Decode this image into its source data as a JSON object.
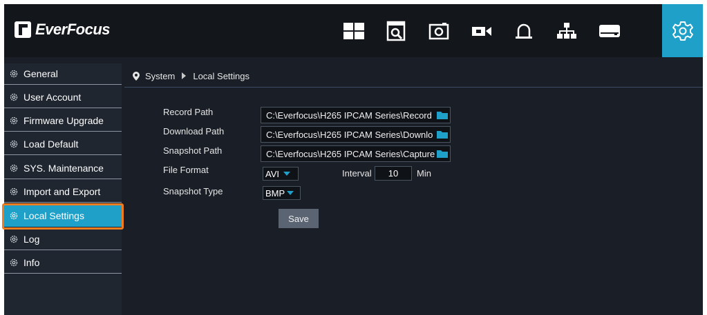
{
  "brand": {
    "logo_text": "EverFocus"
  },
  "top_nav": [
    {
      "name": "live-view",
      "icon": "grid-icon"
    },
    {
      "name": "playback",
      "icon": "playback-search-icon"
    },
    {
      "name": "snapshot",
      "icon": "camera-icon"
    },
    {
      "name": "record",
      "icon": "video-camera-icon"
    },
    {
      "name": "alarm",
      "icon": "alarm-bell-icon"
    },
    {
      "name": "network",
      "icon": "network-icon"
    },
    {
      "name": "storage",
      "icon": "hard-disk-icon"
    },
    {
      "name": "system",
      "icon": "gear-icon",
      "active": true
    }
  ],
  "sidebar": {
    "items": [
      {
        "label": "General"
      },
      {
        "label": "User Account"
      },
      {
        "label": "Firmware Upgrade"
      },
      {
        "label": "Load Default"
      },
      {
        "label": "SYS. Maintenance"
      },
      {
        "label": "Import and Export"
      },
      {
        "label": "Local Settings",
        "active": true
      },
      {
        "label": "Log"
      },
      {
        "label": "Info"
      }
    ]
  },
  "breadcrumb": {
    "root": "System",
    "current": "Local Settings"
  },
  "form": {
    "record_path": {
      "label": "Record Path",
      "value": "C:\\Everfocus\\H265 IPCAM Series\\Record"
    },
    "download_path": {
      "label": "Download Path",
      "value": "C:\\Everfocus\\H265 IPCAM Series\\Downlo"
    },
    "snapshot_path": {
      "label": "Snapshot Path",
      "value": "C:\\Everfocus\\H265 IPCAM Series\\Capture"
    },
    "file_format": {
      "label": "File Format",
      "value": "AVI"
    },
    "interval": {
      "label": "Interval",
      "value": "10",
      "unit": "Min"
    },
    "snapshot_type": {
      "label": "Snapshot Type",
      "value": "BMP"
    },
    "save_label": "Save"
  },
  "colors": {
    "accent": "#1ea0c8",
    "highlight": "#ef7d1f",
    "background": "#1a1f27",
    "topbar": "#13161b"
  }
}
